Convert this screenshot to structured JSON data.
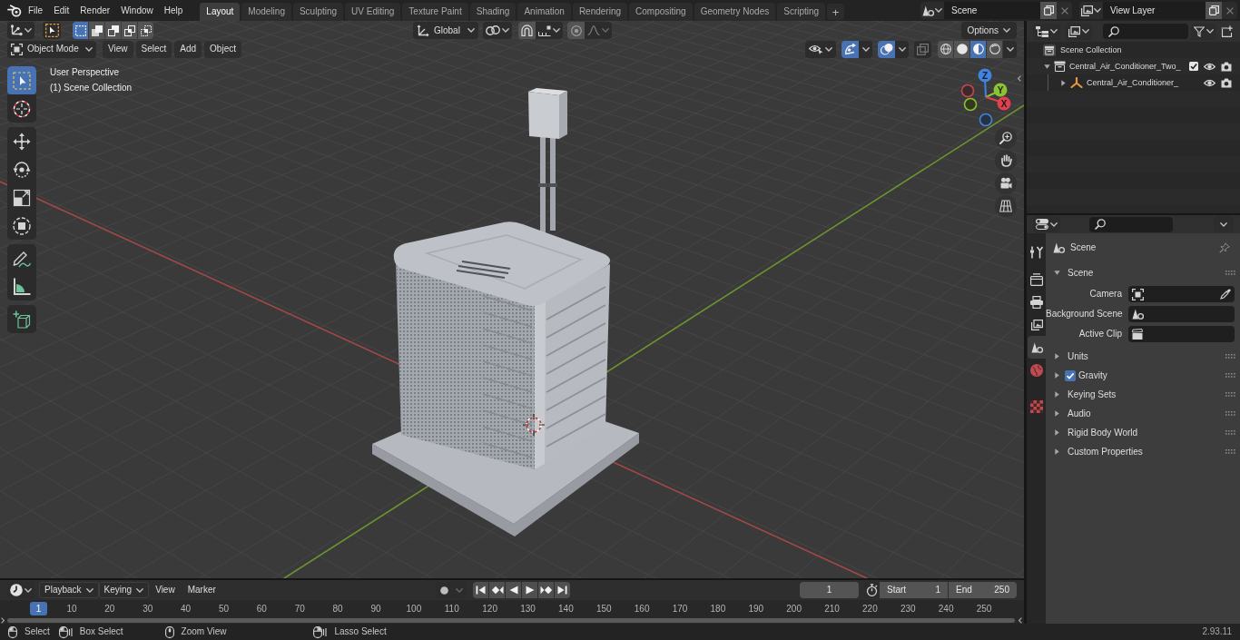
{
  "top_bar": {
    "menus": [
      "File",
      "Edit",
      "Render",
      "Window",
      "Help"
    ],
    "workspaces": [
      {
        "label": "Layout",
        "selected": true
      },
      {
        "label": "Modeling",
        "selected": false
      },
      {
        "label": "Sculpting",
        "selected": false
      },
      {
        "label": "UV Editing",
        "selected": false
      },
      {
        "label": "Texture Paint",
        "selected": false
      },
      {
        "label": "Shading",
        "selected": false
      },
      {
        "label": "Animation",
        "selected": false
      },
      {
        "label": "Rendering",
        "selected": false
      },
      {
        "label": "Compositing",
        "selected": false
      },
      {
        "label": "Geometry Nodes",
        "selected": false
      },
      {
        "label": "Scripting",
        "selected": false
      }
    ],
    "add_workspace": "+",
    "scene": "Scene",
    "view_layer": "View Layer"
  },
  "viewport": {
    "header": {
      "select_modes": [
        {
          "kind": "set",
          "selected": true
        },
        {
          "kind": "extend",
          "selected": false
        },
        {
          "kind": "subtract",
          "selected": false
        },
        {
          "kind": "difference",
          "selected": false
        },
        {
          "kind": "intersect",
          "selected": false
        }
      ],
      "orientation": "Global",
      "options": "Options",
      "mode": "Object Mode",
      "menus": [
        "View",
        "Select",
        "Add",
        "Object"
      ],
      "toggles": [
        {
          "kind": "gizmo",
          "on": true
        },
        {
          "kind": "overlay",
          "on": true
        },
        {
          "kind": "xray",
          "on": false
        }
      ],
      "shading": [
        {
          "kind": "wireframe",
          "selected": false
        },
        {
          "kind": "solid",
          "selected": false
        },
        {
          "kind": "material",
          "selected": true
        },
        {
          "kind": "rendered",
          "selected": false
        }
      ]
    },
    "tools": [
      {
        "kind": "select",
        "selected": true
      },
      {
        "kind": "cursor",
        "selected": false
      },
      {
        "kind": "move",
        "selected": false
      },
      {
        "kind": "rotate",
        "selected": false
      },
      {
        "kind": "scale",
        "selected": false
      },
      {
        "kind": "transform",
        "selected": false
      },
      {
        "kind": "annotate",
        "selected": false
      },
      {
        "kind": "measure",
        "selected": false
      },
      {
        "kind": "cube",
        "selected": false
      }
    ],
    "view_name": "User Perspective",
    "collection": "(1) Scene Collection",
    "gizmo_axes": [
      "X",
      "Y",
      "Z"
    ]
  },
  "outliner": {
    "root": "Scene Collection",
    "items": [
      {
        "label": "Central_Air_Conditioner_Two_",
        "kind": "collection",
        "expanded": true,
        "checked": true,
        "visible": true,
        "renderable": true,
        "children": [
          {
            "label": "Central_Air_Conditioner_",
            "kind": "empty",
            "expanded": false,
            "visible": true,
            "renderable": true
          }
        ]
      }
    ]
  },
  "properties": {
    "tabs": [
      {
        "kind": "tool",
        "selected": false
      },
      {
        "kind": "render",
        "selected": false
      },
      {
        "kind": "output",
        "selected": false
      },
      {
        "kind": "viewlayer",
        "selected": false
      },
      {
        "kind": "scene",
        "selected": true
      },
      {
        "kind": "world",
        "selected": false
      },
      {
        "kind": "texture",
        "selected": false
      }
    ],
    "context": "Scene",
    "panels": [
      {
        "label": "Scene",
        "kind": "plain",
        "expanded": true,
        "fields": [
          {
            "label": "Camera",
            "kind": "object"
          },
          {
            "label": "Background Scene",
            "kind": "scene"
          },
          {
            "label": "Active Clip",
            "kind": "clip"
          }
        ]
      },
      {
        "label": "Units",
        "kind": "plain",
        "expanded": false
      },
      {
        "label": "Gravity",
        "kind": "toggle",
        "expanded": false,
        "checked": true
      },
      {
        "label": "Keying Sets",
        "kind": "plain",
        "expanded": false
      },
      {
        "label": "Audio",
        "kind": "plain",
        "expanded": false
      },
      {
        "label": "Rigid Body World",
        "kind": "plain",
        "expanded": false
      },
      {
        "label": "Custom Properties",
        "kind": "plain",
        "expanded": false
      }
    ]
  },
  "timeline": {
    "menus": [
      {
        "label": "Playback",
        "kind": "dropdown"
      },
      {
        "label": "Keying",
        "kind": "dropdown"
      },
      {
        "label": "View",
        "kind": "plain"
      },
      {
        "label": "Marker",
        "kind": "plain"
      }
    ],
    "auto_keying": false,
    "current_frame": "1",
    "start_label": "Start",
    "start": "1",
    "end_label": "End",
    "end": "250",
    "playhead": "1",
    "ruler": [
      "10",
      "20",
      "30",
      "40",
      "50",
      "60",
      "70",
      "80",
      "90",
      "100",
      "110",
      "120",
      "130",
      "140",
      "150",
      "160",
      "170",
      "180",
      "190",
      "200",
      "210",
      "220",
      "230",
      "240",
      "250"
    ]
  },
  "status_bar": {
    "hints": [
      {
        "kind": "click",
        "label": "Select"
      },
      {
        "kind": "drag",
        "label": "Box Select"
      },
      {
        "kind": "middle",
        "label": "Zoom View"
      },
      {
        "kind": "lasso",
        "label": "Lasso Select"
      }
    ],
    "version": "2.93.11"
  }
}
